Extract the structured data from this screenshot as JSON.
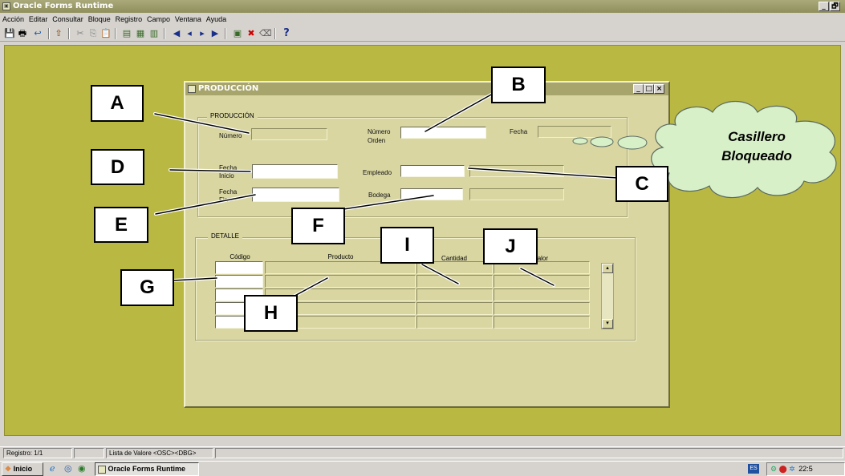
{
  "window": {
    "title": "Oracle Forms Runtime",
    "controls": {
      "minimize": "_",
      "restore": "🗗"
    }
  },
  "menu": [
    "Acción",
    "Editar",
    "Consultar",
    "Bloque",
    "Registro",
    "Campo",
    "Ventana",
    "Ayuda"
  ],
  "toolbar": {
    "icons": [
      "save-icon",
      "print-icon",
      "exit-icon",
      "enter-query-icon",
      "cut-icon",
      "copy-icon",
      "paste-icon",
      "list-of-values-icon",
      "edit-icon",
      "execute-query-icon",
      "first-record-icon",
      "previous-record-icon",
      "next-record-icon",
      "last-record-icon",
      "insert-record-icon",
      "delete-record-icon",
      "clear-record-icon",
      "help-icon"
    ],
    "help_label": "?"
  },
  "form": {
    "title": "PRODUCCIÓN",
    "controls": {
      "minimize": "_",
      "maximize": "□",
      "close": "×"
    },
    "produccion": {
      "frame_title": "PRODUCCIÓN",
      "numero_label": "Número",
      "numero_orden_label_1": "Número",
      "numero_orden_label_2": "Orden",
      "fecha_label": "Fecha",
      "fecha_inicio_label_1": "Fecha",
      "fecha_inicio_label_2": "Inicio",
      "empleado_label": "Empleado",
      "fecha_fin_label_1": "Fecha",
      "fecha_fin_label_2": "Fin",
      "bodega_label": "Bodega"
    },
    "detalle": {
      "frame_title": "DETALLE",
      "columns": [
        "Código",
        "Producto",
        "Cantidad",
        "Valor"
      ]
    }
  },
  "annotations": {
    "A": "A",
    "B": "B",
    "C": "C",
    "D": "D",
    "E": "E",
    "F": "F",
    "G": "G",
    "H": "H",
    "I": "I",
    "J": "J",
    "cloud_line1": "Casillero",
    "cloud_line2": "Bloqueado"
  },
  "statusbar": {
    "record": "Registro: 1/1",
    "lov": "Lista de Valore",
    "osc": "<OSC>",
    "dbg": "<DBG>"
  },
  "taskbar": {
    "start": "Inicio",
    "app_button": "Oracle Forms Runtime",
    "lang": "ES",
    "clock": "22:5"
  },
  "colors": {
    "workspace": "#b9b843",
    "form_bg": "#d9d6a2",
    "cloud": "#d8f0c8"
  }
}
